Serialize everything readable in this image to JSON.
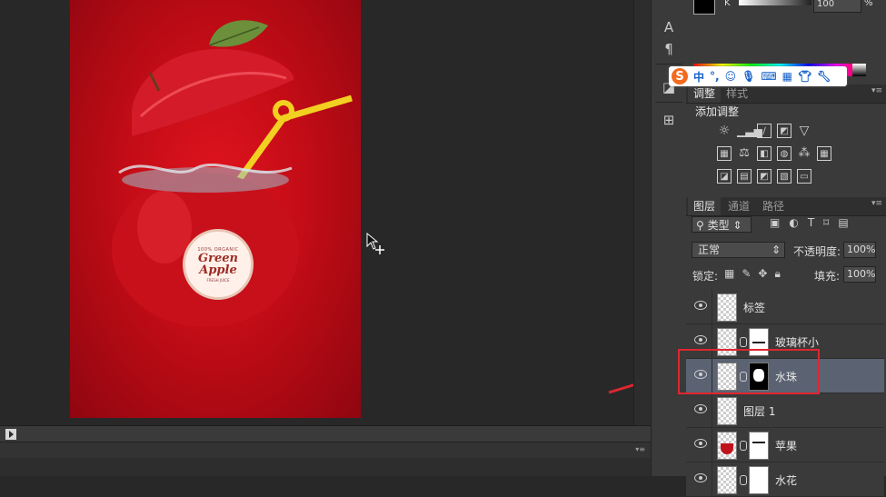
{
  "canvas": {
    "badge": {
      "top_text": "100% ORGANIC",
      "main_line1": "Green",
      "main_line2": "Apple",
      "bottom_text": "FRESH JUICE"
    }
  },
  "color_panel": {
    "channel_label": "K",
    "channel_value": "100",
    "channel_unit": "%"
  },
  "ime_toolbar": {
    "logo": "S",
    "mode": "中",
    "punct": "°,"
  },
  "adjust_panel": {
    "tabs": [
      "调整",
      "样式"
    ],
    "title": "添加调整"
  },
  "layers_panel": {
    "tabs": [
      "图层",
      "通道",
      "路径"
    ],
    "filter_kind": "类型",
    "blend_mode": "正常",
    "opacity_label": "不透明度:",
    "opacity_value": "100%",
    "lock_label": "锁定:",
    "fill_label": "填充:",
    "fill_value": "100%",
    "layers": [
      {
        "name": "标签",
        "has_mask": false,
        "selected": false
      },
      {
        "name": "玻璃杯小",
        "has_mask": true,
        "selected": false
      },
      {
        "name": "水珠",
        "has_mask": true,
        "selected": true
      },
      {
        "name": "图层 1",
        "has_mask": false,
        "selected": false
      },
      {
        "name": "苹果",
        "has_mask": true,
        "selected": false
      },
      {
        "name": "水花",
        "has_mask": true,
        "selected": false
      }
    ]
  },
  "colors": {
    "accent_red": "#e0262f",
    "selected_layer": "#5b6272",
    "panel_bg": "#3a3a3a"
  },
  "icons": [
    "text-tool-icon",
    "paragraph-icon",
    "3d-icon",
    "layer-comps-icon"
  ]
}
